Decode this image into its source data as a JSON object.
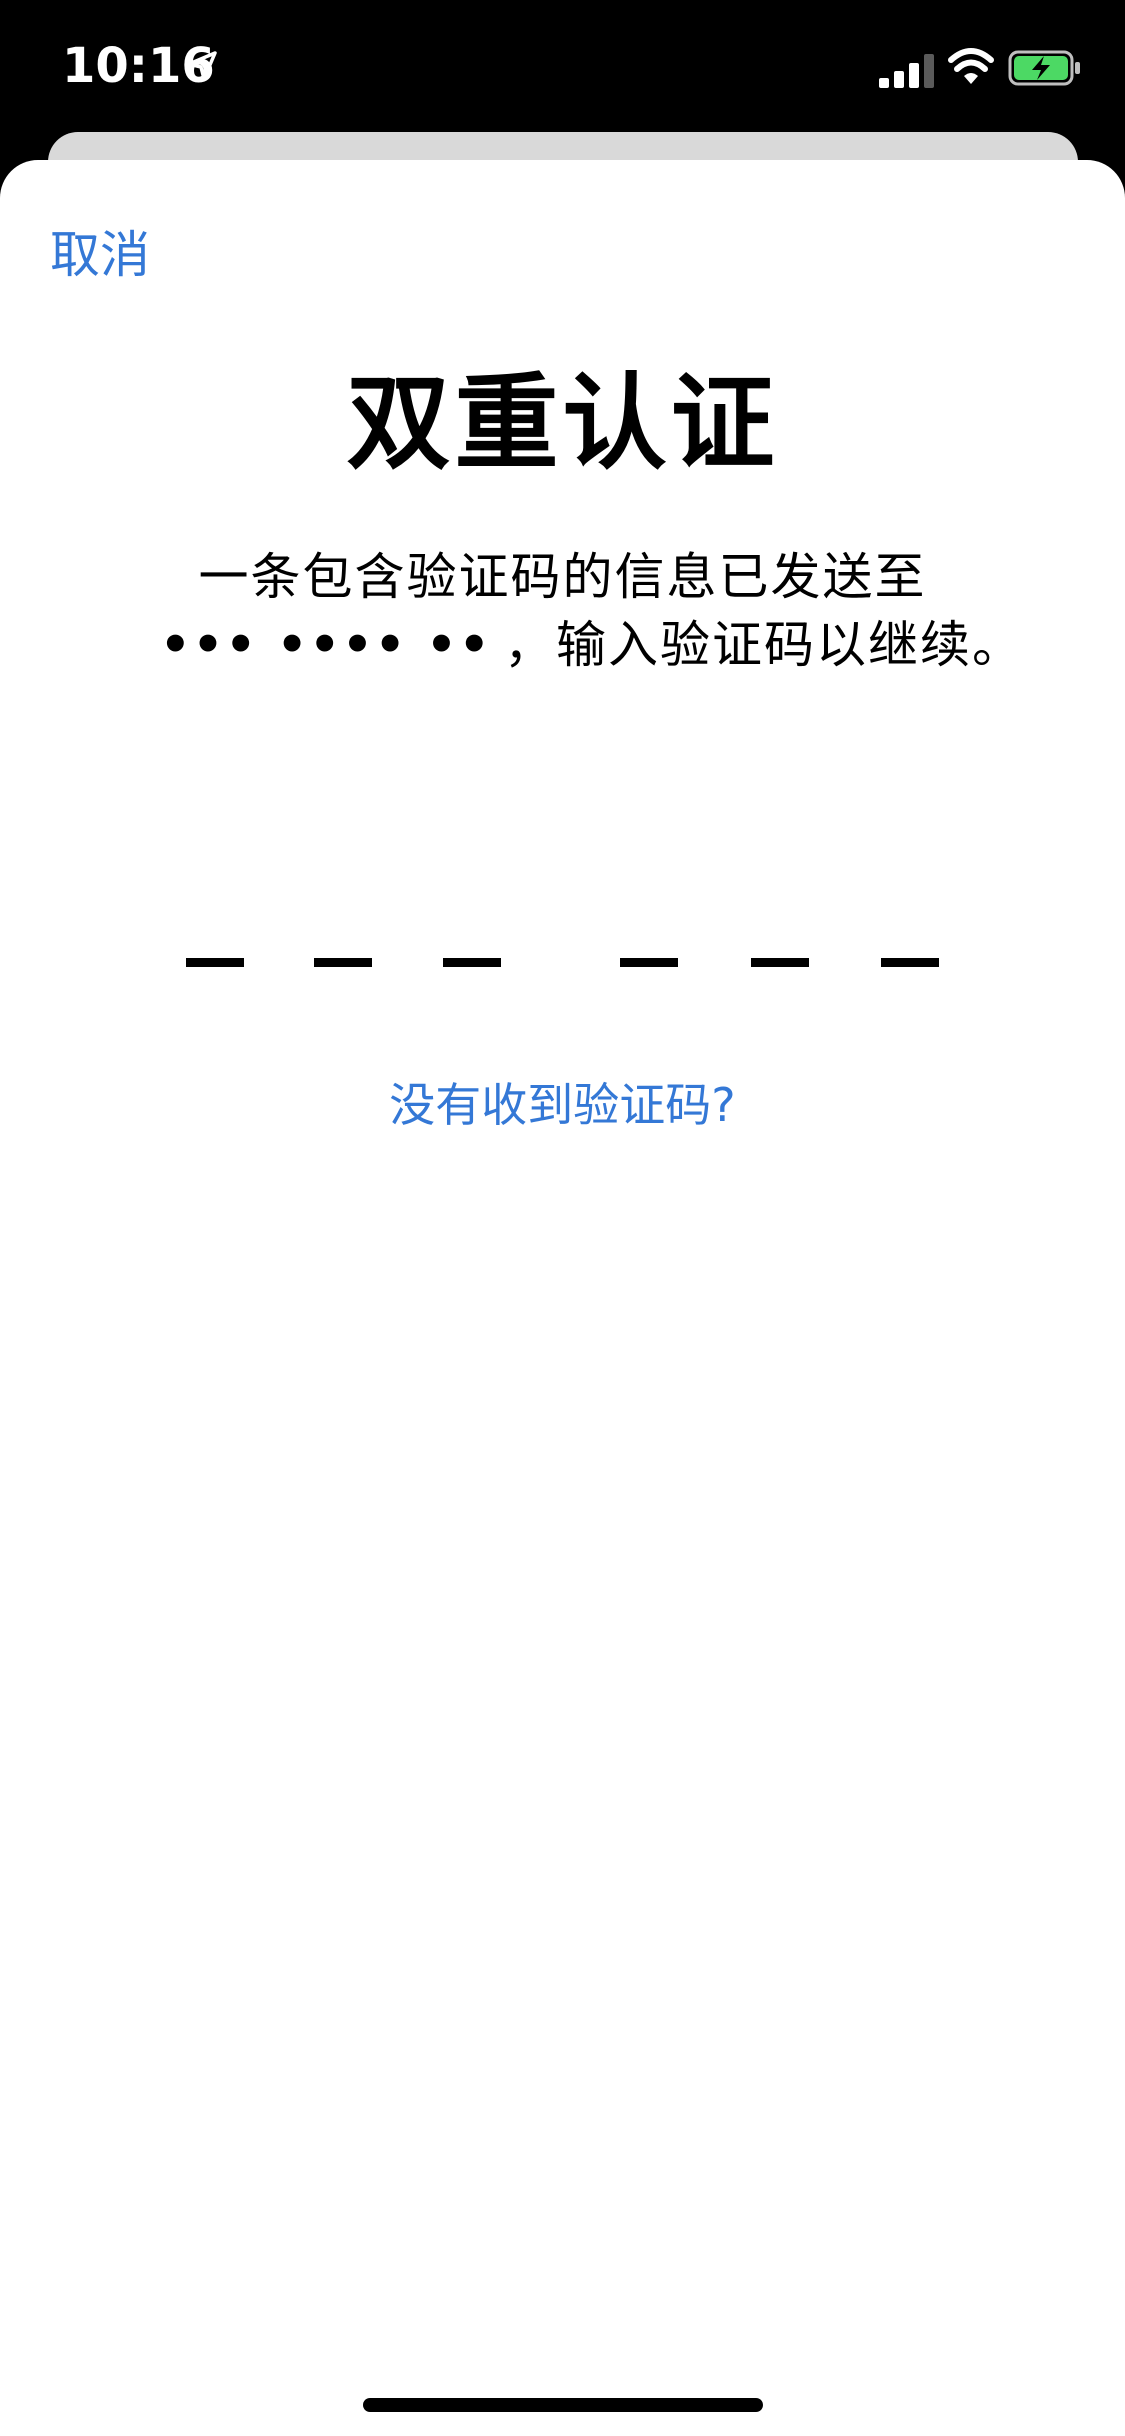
{
  "status_bar": {
    "time": "10:16",
    "icons": [
      "location-arrow-icon",
      "cellular-signal-icon",
      "wifi-icon",
      "battery-charging-icon"
    ],
    "battery_color": "#4cd964"
  },
  "sheet": {
    "cancel_label": "取消",
    "title": "双重认证",
    "description_line1": "一条包含验证码的信息已发送至",
    "masked_number": "••• •••• ••",
    "description_line2": "，输入验证码以继续。",
    "code_slots": [
      "",
      "",
      "",
      "",
      "",
      ""
    ],
    "resend_label": "没有收到验证码?"
  },
  "colors": {
    "accent": "#3478d6",
    "text": "#000000",
    "background": "#ffffff"
  }
}
